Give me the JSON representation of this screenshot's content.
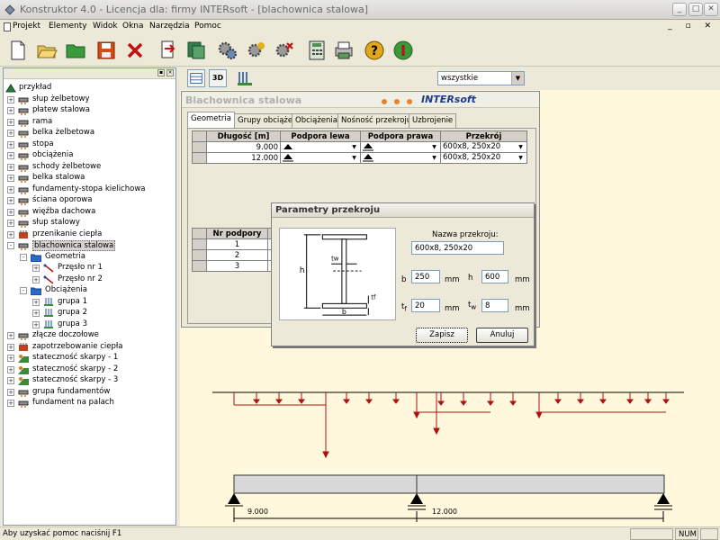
{
  "window": {
    "title": "Konstruktor 4.0 - Licencja dla: firmy INTERsoft - [blachownica stalowa]"
  },
  "menu": [
    "Projekt",
    "Elementy",
    "Widok",
    "Okna",
    "Narzędzia",
    "Pomoc"
  ],
  "toolbar_icons": [
    "new-icon",
    "open-icon",
    "folder-icon",
    "save-icon",
    "delete-icon",
    "export-icon",
    "module-icon",
    "settings-gear-icon",
    "gear-add-icon",
    "gear-remove-icon",
    "calculator-icon",
    "print-icon",
    "help-icon",
    "info-icon"
  ],
  "tree": {
    "root": "przykład",
    "items": [
      {
        "label": "słup żelbetowy",
        "icon": "column-icon",
        "level": 1,
        "expander": "+"
      },
      {
        "label": "płatew stalowa",
        "icon": "purlin-icon",
        "level": 1,
        "expander": "+"
      },
      {
        "label": "rama",
        "icon": "frame-icon",
        "level": 1,
        "expander": "+"
      },
      {
        "label": "belka żelbetowa",
        "icon": "beam-icon",
        "level": 1,
        "expander": "+"
      },
      {
        "label": "stopa",
        "icon": "footing-icon",
        "level": 1,
        "expander": "+"
      },
      {
        "label": "obciążenia",
        "icon": "loads-icon",
        "level": 1,
        "expander": "+"
      },
      {
        "label": "schody żelbetowe",
        "icon": "stairs-icon",
        "level": 1,
        "expander": "+"
      },
      {
        "label": "belka stalowa",
        "icon": "steel-beam-icon",
        "level": 1,
        "expander": "+"
      },
      {
        "label": "fundamenty-stopa kielichowa",
        "icon": "socket-footing-icon",
        "level": 1,
        "expander": "+"
      },
      {
        "label": "ściana oporowa",
        "icon": "retaining-wall-icon",
        "level": 1,
        "expander": "+"
      },
      {
        "label": "więźba dachowa",
        "icon": "roof-truss-icon",
        "level": 1,
        "expander": "+"
      },
      {
        "label": "słup stalowy",
        "icon": "steel-column-icon",
        "level": 1,
        "expander": "+"
      },
      {
        "label": "przenikanie ciepła",
        "icon": "heat-icon",
        "level": 1,
        "expander": "+"
      },
      {
        "label": "blachownica stalowa",
        "icon": "plate-girder-icon",
        "level": 1,
        "expander": "-",
        "selected": true
      },
      {
        "label": "Geometria",
        "icon": "folder-icon",
        "level": 2,
        "expander": "-"
      },
      {
        "label": "Przęsło nr 1",
        "icon": "span-icon",
        "level": 3,
        "expander": "+"
      },
      {
        "label": "Przęsło nr 2",
        "icon": "span-icon",
        "level": 3,
        "expander": "+"
      },
      {
        "label": "Obciążenia",
        "icon": "folder-icon",
        "level": 2,
        "expander": "-"
      },
      {
        "label": "grupa 1",
        "icon": "load-group-icon",
        "level": 3,
        "expander": "+"
      },
      {
        "label": "grupa 2",
        "icon": "load-group-icon",
        "level": 3,
        "expander": "+"
      },
      {
        "label": "grupa 3",
        "icon": "load-group-icon",
        "level": 3,
        "expander": "+"
      },
      {
        "label": "złącze doczołowe",
        "icon": "joint-icon",
        "level": 1,
        "expander": "+"
      },
      {
        "label": "zapotrzebowanie ciepła",
        "icon": "heat-demand-icon",
        "level": 1,
        "expander": "+"
      },
      {
        "label": "stateczność skarpy - 1",
        "icon": "slope-icon",
        "level": 1,
        "expander": "+"
      },
      {
        "label": "stateczność skarpy - 2",
        "icon": "slope-icon",
        "level": 1,
        "expander": "+"
      },
      {
        "label": "stateczność skarpy - 3",
        "icon": "slope-icon",
        "level": 1,
        "expander": "+"
      },
      {
        "label": "grupa fundamentów",
        "icon": "foundation-group-icon",
        "level": 1,
        "expander": "+"
      },
      {
        "label": "fundament na palach",
        "icon": "pile-foundation-icon",
        "level": 1,
        "expander": "+"
      }
    ]
  },
  "right_toolbar": {
    "btn_3d": "3D",
    "filter": "wszystkie"
  },
  "module_window": {
    "title": "Blachownica stalowa",
    "brand": "INTERsoft",
    "tabs": [
      "Geometria",
      "Grupy obciążeń",
      "Obciążenia",
      "Nośność przekroju",
      "Uzbrojenie"
    ],
    "active_tab": 0,
    "span_table": {
      "headers": [
        "Długość [m]",
        "Podpora lewa",
        "Podpora prawa",
        "Przekrój"
      ],
      "rows": [
        {
          "length": "9.000",
          "left": "",
          "right": "",
          "section": "600x8, 250x20"
        },
        {
          "length": "12.000",
          "left": "",
          "right": "",
          "section": "600x8, 250x20"
        }
      ]
    },
    "support_table": {
      "header": "Nr podpory",
      "rows": [
        "1",
        "2",
        "3"
      ]
    }
  },
  "section_dialog": {
    "title": "Parametry przekroju",
    "name_label": "Nazwa przekroju:",
    "name_value": "600x8, 250x20",
    "b_label": "b",
    "b_value": "250",
    "b_unit": "mm",
    "h_label": "h",
    "h_value": "600",
    "h_unit": "mm",
    "tf_label": "t",
    "tf_sub": "f",
    "tf_value": "20",
    "tf_unit": "mm",
    "tw_label": "t",
    "tw_sub": "w",
    "tw_value": "8",
    "tw_unit": "mm",
    "save_label": "Zapisz",
    "cancel_label": "Anuluj",
    "diagram_labels": {
      "h": "h",
      "tw": "tw",
      "tf": "tf",
      "b": "b"
    }
  },
  "beam": {
    "span1_label": "9.000",
    "span2_label": "12.000"
  },
  "status": {
    "message": "Aby uzyskać pomoc naciśnij F1",
    "num": "NUM"
  },
  "colors": {
    "load_arrow": "#b01010",
    "canvas_bg": "#fff8dc",
    "brand": "#1e3a8a",
    "accent_dots": "#f08020"
  }
}
